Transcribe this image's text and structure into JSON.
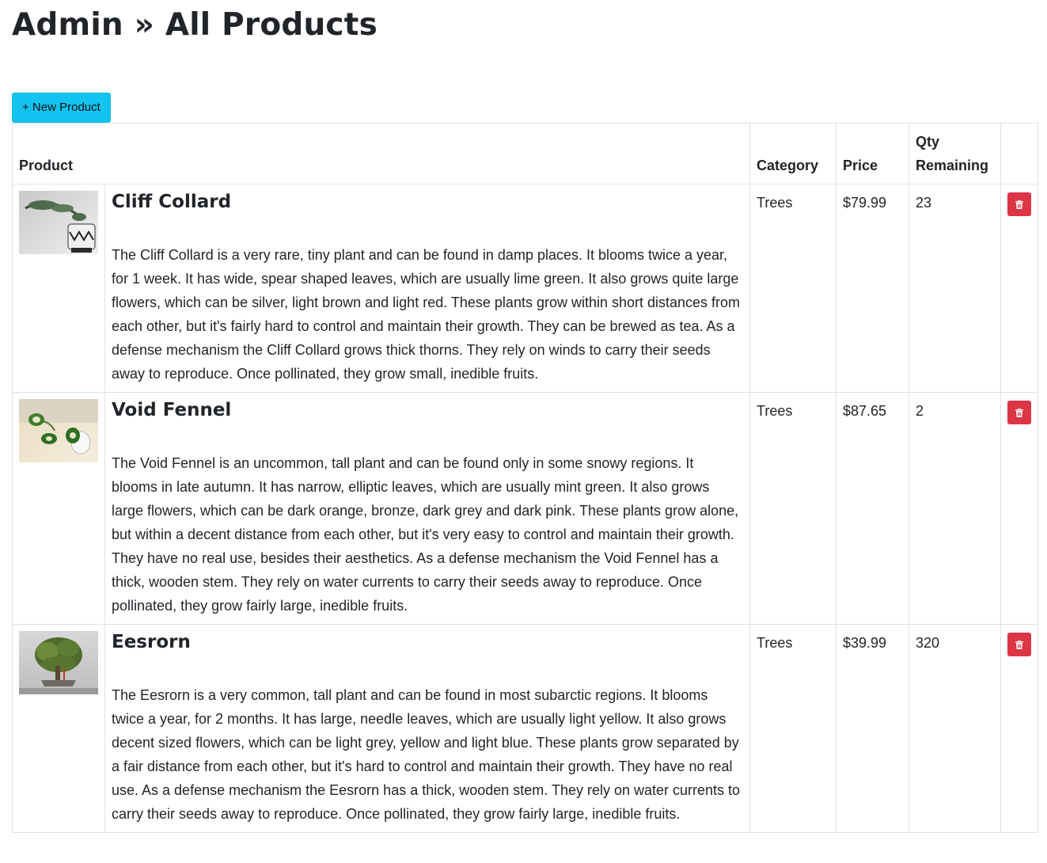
{
  "header": {
    "title": "Admin » All Products"
  },
  "toolbar": {
    "new_product_label": "+ New Product"
  },
  "table": {
    "columns": {
      "product": "Product",
      "category": "Category",
      "price": "Price",
      "qty": "Qty Remaining"
    },
    "rows": [
      {
        "name": "Cliff Collard",
        "description": "The Cliff Collard is a very rare, tiny plant and can be found in damp places. It blooms twice a year, for 1 week. It has wide, spear shaped leaves, which are usually lime green. It also grows quite large flowers, which can be silver, light brown and light red. These plants grow within short distances from each other, but it's fairly hard to control and maintain their growth. They can be brewed as tea. As a defense mechanism the Cliff Collard grows thick thorns. They rely on winds to carry their seeds away to reproduce. Once pollinated, they grow small, inedible fruits.",
        "category": "Trees",
        "price": "$79.99",
        "qty": "23"
      },
      {
        "name": "Void Fennel",
        "description": "The Void Fennel is an uncommon, tall plant and can be found only in some snowy regions. It blooms in late autumn. It has narrow, elliptic leaves, which are usually mint green. It also grows large flowers, which can be dark orange, bronze, dark grey and dark pink. These plants grow alone, but within a decent distance from each other, but it's very easy to control and maintain their growth. They have no real use, besides their aesthetics. As a defense mechanism the Void Fennel has a thick, wooden stem. They rely on water currents to carry their seeds away to reproduce. Once pollinated, they grow fairly large, inedible fruits.",
        "category": "Trees",
        "price": "$87.65",
        "qty": "2"
      },
      {
        "name": "Eesrorn",
        "description": "The Eesrorn is a very common, tall plant and can be found in most subarctic regions. It blooms twice a year, for 2 months. It has large, needle leaves, which are usually light yellow. It also grows decent sized flowers, which can be light grey, yellow and light blue. These plants grow separated by a fair distance from each other, but it's hard to control and maintain their growth. They have no real use. As a defense mechanism the Eesrorn has a thick, wooden stem. They rely on water currents to carry their seeds away to reproduce. Once pollinated, they grow fairly large, inedible fruits.",
        "category": "Trees",
        "price": "$39.99",
        "qty": "320"
      }
    ]
  },
  "colors": {
    "new_button": "#13c3ef",
    "delete_button": "#dc3545",
    "border": "#dee2e6"
  },
  "icons": {
    "delete": "trash-icon"
  }
}
